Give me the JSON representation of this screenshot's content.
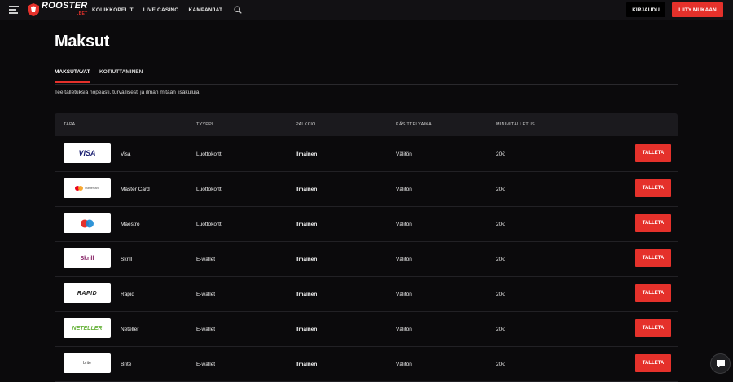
{
  "header": {
    "logo_text": "ROOSTER",
    "logo_sub": ".BET",
    "nav": [
      "KOLIKKOPELIT",
      "LIVE CASINO",
      "KAMPANJAT"
    ],
    "login_label": "KIRJAUDU",
    "join_label": "LIITY MUKAAN"
  },
  "page": {
    "title": "Maksut",
    "tabs": [
      "MAKSUTAVAT",
      "KOTIUTTAMINEN"
    ],
    "intro": "Tee talletuksia nopeasti, turvallisesti ja ilman mitään lisäkuluja."
  },
  "table": {
    "headers": [
      "TAPA",
      "TYYPPI",
      "PALKKIO",
      "KÄSITTELYAIKA",
      "MINIMITALLETUS"
    ],
    "rows": [
      {
        "name": "Visa",
        "type": "Luottokortti",
        "fee": "Ilmainen",
        "time": "Välitön",
        "min": "20€",
        "button": "TALLETA",
        "logo": "VISA"
      },
      {
        "name": "Master Card",
        "type": "Luottokortti",
        "fee": "Ilmainen",
        "time": "Välitön",
        "min": "20€",
        "button": "TALLETA",
        "logo": "mastercard"
      },
      {
        "name": "Maestro",
        "type": "Luottokortti",
        "fee": "Ilmainen",
        "time": "Välitön",
        "min": "20€",
        "button": "TALLETA",
        "logo": "maestro"
      },
      {
        "name": "Skrill",
        "type": "E-wallet",
        "fee": "Ilmainen",
        "time": "Välitön",
        "min": "20€",
        "button": "TALLETA",
        "logo": "Skrill"
      },
      {
        "name": "Rapid",
        "type": "E-wallet",
        "fee": "Ilmainen",
        "time": "Välitön",
        "min": "20€",
        "button": "TALLETA",
        "logo": "RAPID"
      },
      {
        "name": "Neteller",
        "type": "E-wallet",
        "fee": "Ilmainen",
        "time": "Välitön",
        "min": "20€",
        "button": "TALLETA",
        "logo": "NETELLER"
      },
      {
        "name": "Brite",
        "type": "E-wallet",
        "fee": "Ilmainen",
        "time": "Välitön",
        "min": "20€",
        "button": "TALLETA",
        "logo": "brite"
      }
    ]
  },
  "colors": {
    "accent": "#e5312b",
    "background": "#0b0a0c",
    "header_bg": "#1b1a1e"
  }
}
